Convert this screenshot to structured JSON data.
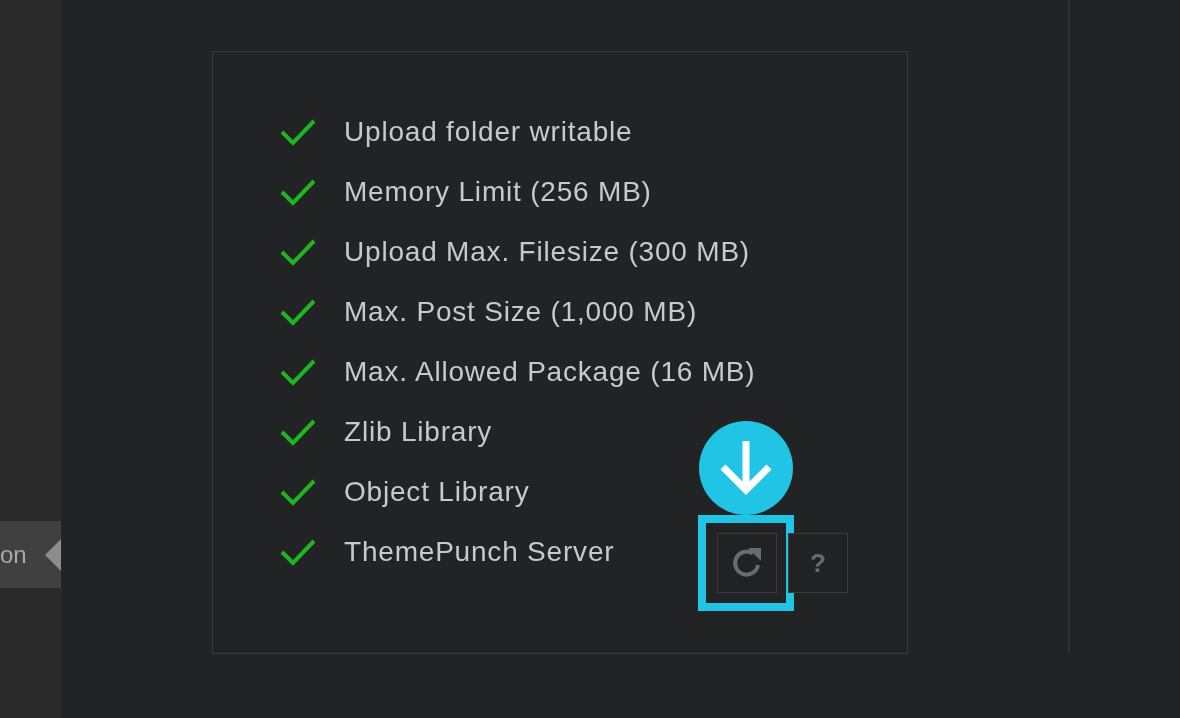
{
  "sidebar": {
    "tab": {
      "label": "on",
      "selected": true
    }
  },
  "checklist": {
    "items": [
      {
        "label": "Upload folder writable",
        "checked": true
      },
      {
        "label": "Memory Limit (256 MB)",
        "checked": true
      },
      {
        "label": "Upload Max. Filesize (300 MB)",
        "checked": true
      },
      {
        "label": "Max. Post Size (1,000 MB)",
        "checked": true
      },
      {
        "label": "Max. Allowed Package (16 MB)",
        "checked": true
      },
      {
        "label": "Zlib Library",
        "checked": true
      },
      {
        "label": "Object Library",
        "checked": true
      },
      {
        "label": "ThemePunch Server",
        "checked": true
      }
    ],
    "buttons": [
      {
        "kind": "refresh",
        "highlighted": true
      },
      {
        "kind": "help",
        "label": "?",
        "highlighted": false
      }
    ]
  }
}
